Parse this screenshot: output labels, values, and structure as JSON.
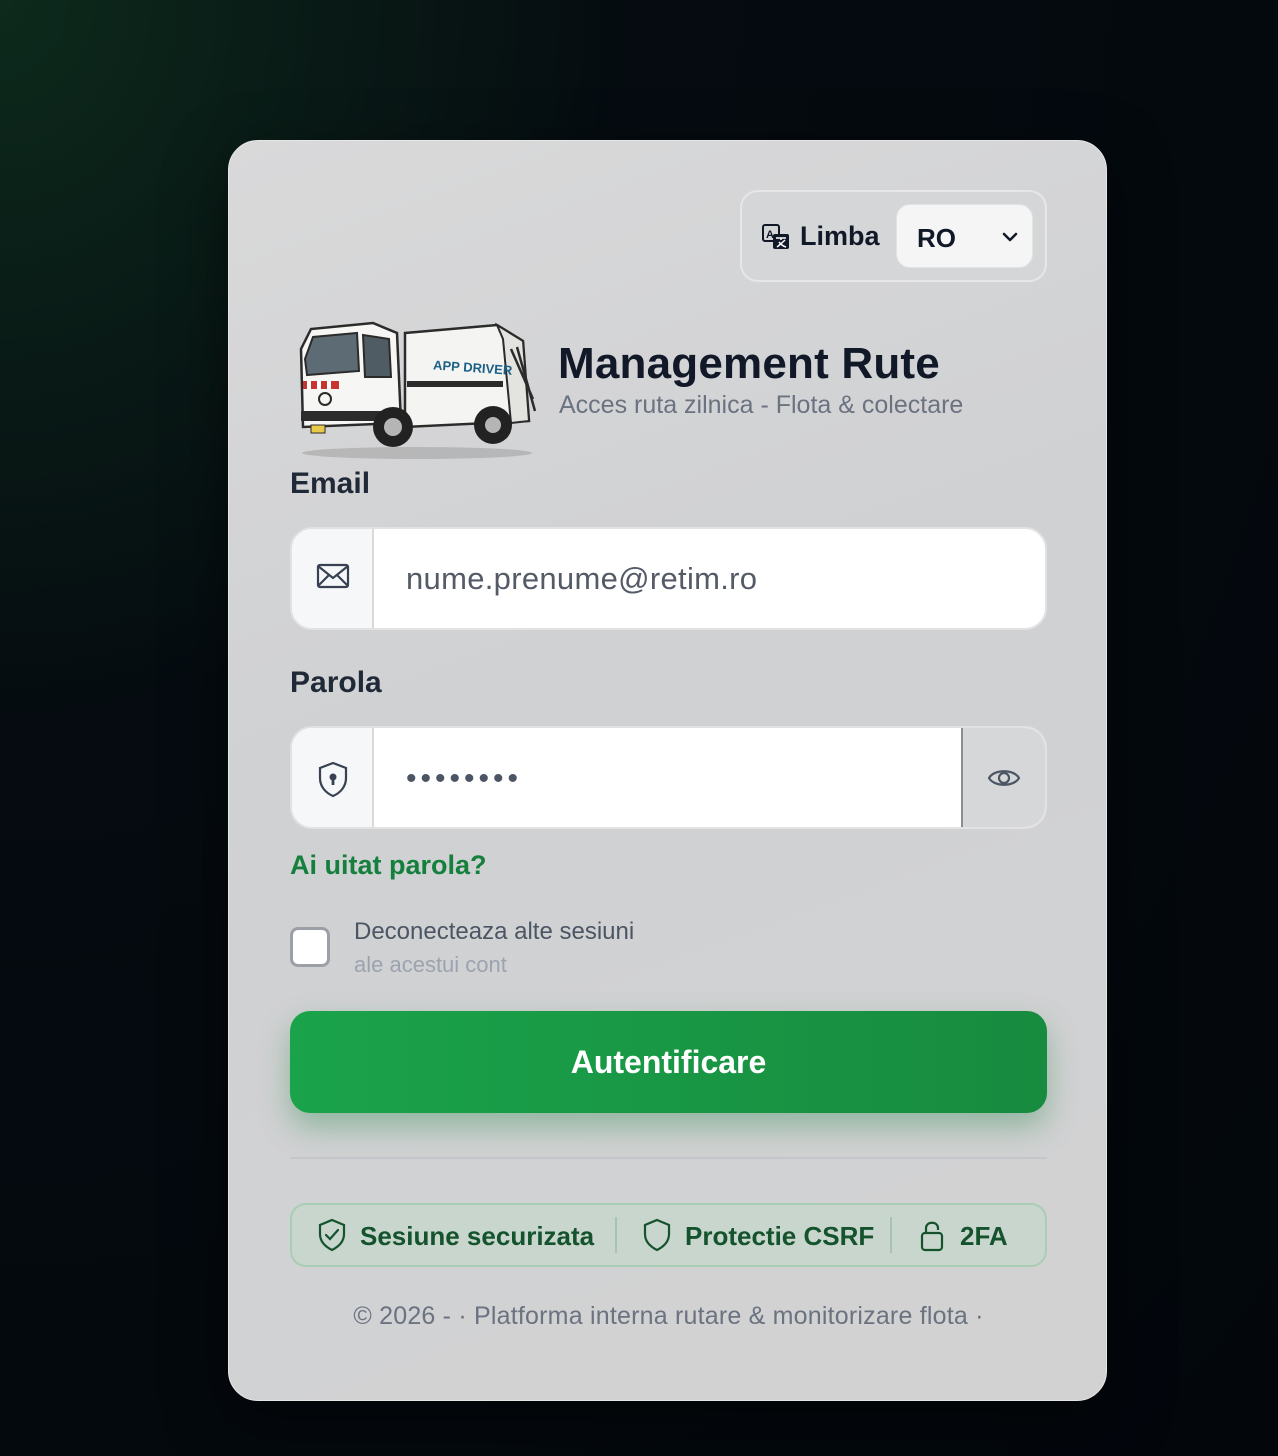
{
  "language": {
    "label": "Limba",
    "selected": "RO"
  },
  "header": {
    "title": "Management Rute",
    "subtitle": "Acces ruta zilnica - Flota & colectare",
    "truck_text": "APP DRIVER"
  },
  "email": {
    "label": "Email",
    "placeholder": "nume.prenume@retim.ro"
  },
  "password": {
    "label": "Parola",
    "value": "••••••••"
  },
  "forgot_link": "Ai uitat parola?",
  "logout_others": {
    "label": "Deconecteaza alte sesiuni",
    "sublabel": "ale acestui cont",
    "checked": false
  },
  "submit_label": "Autentificare",
  "badges": [
    {
      "label": "Sesiune securizata",
      "icon": "shield-check-icon"
    },
    {
      "label": "Protectie CSRF",
      "icon": "shield-icon"
    },
    {
      "label": "2FA",
      "icon": "lock-icon"
    }
  ],
  "footer": "© 2026 - · Platforma interna rutare & monitorizare flota ·",
  "colors": {
    "accent": "#15803d",
    "button": "#1aa34a",
    "card": "#d3d3d4",
    "background": "#03070c"
  }
}
